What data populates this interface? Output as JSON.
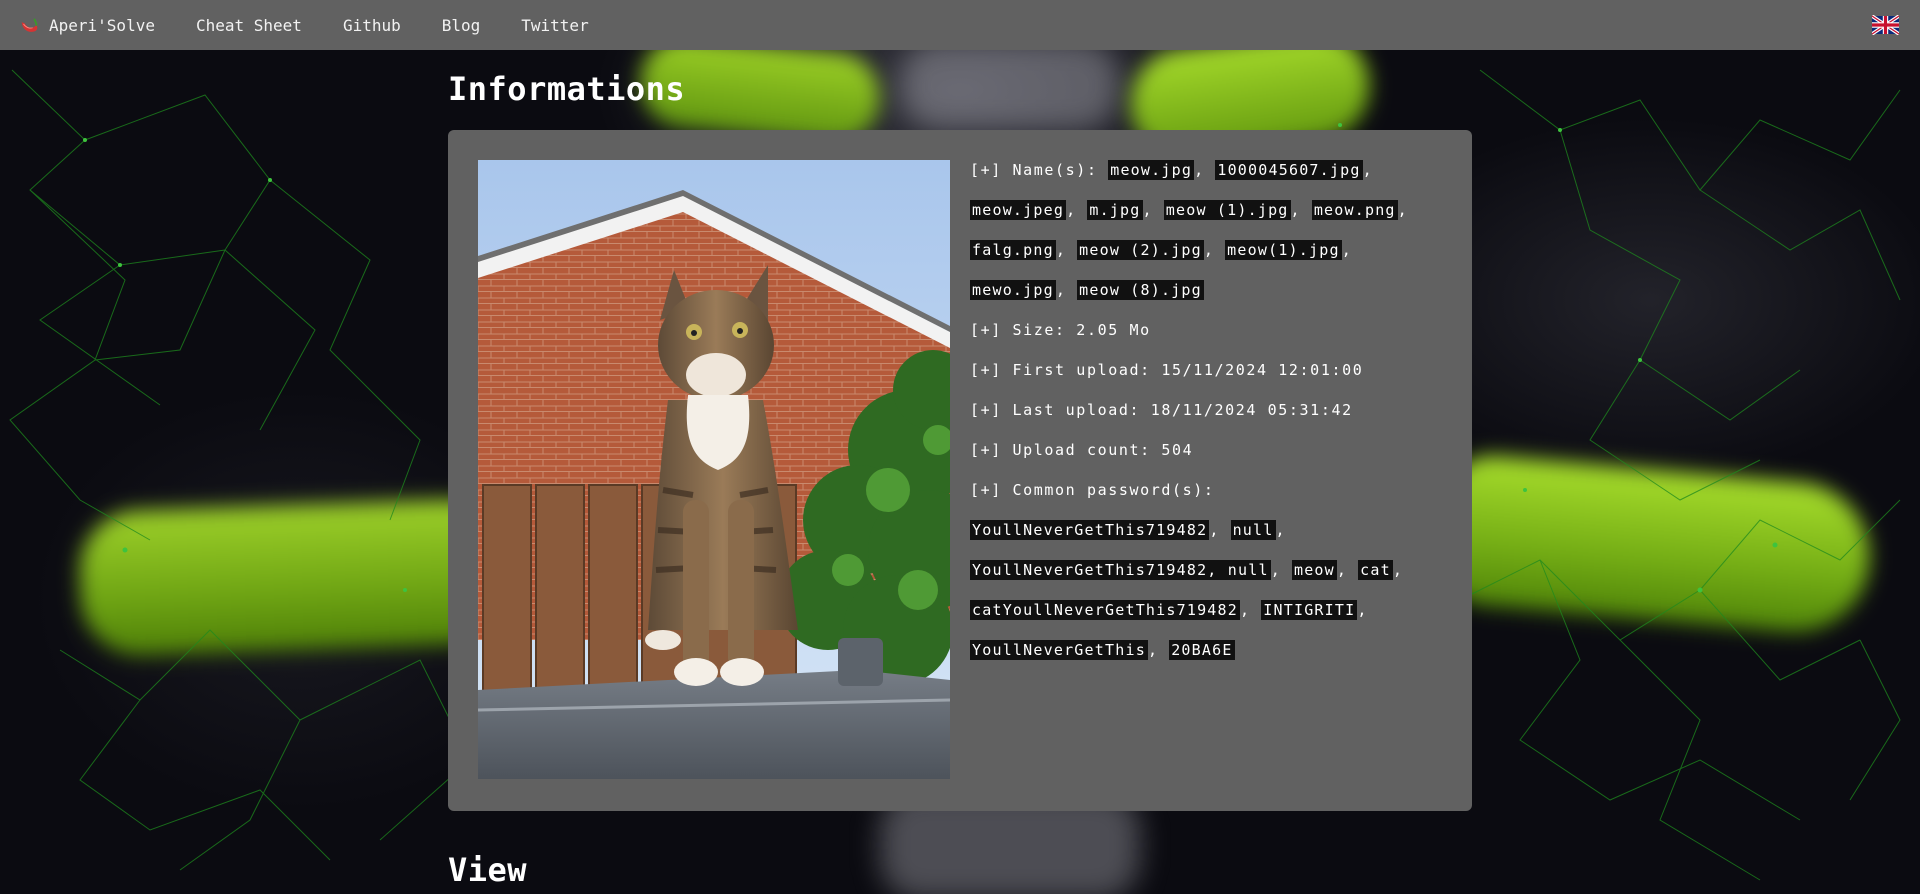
{
  "nav": {
    "brand": "Aperi'Solve",
    "links": [
      "Cheat Sheet",
      "Github",
      "Blog",
      "Twitter"
    ],
    "language_icon": "uk-flag-icon"
  },
  "informations": {
    "title": "Informations",
    "names_label": "[+] Name(s):",
    "names": [
      "meow.jpg",
      "1000045607.jpg",
      "meow.jpeg",
      "m.jpg",
      "meow (1).jpg",
      "meow.png",
      "falg.png",
      "meow (2).jpg",
      "meow(1).jpg",
      "mewo.jpg",
      "meow (8).jpg"
    ],
    "size": "[+] Size: 2.05 Mo",
    "first_upload": "[+] First upload: 15/11/2024 12:01:00",
    "last_upload": "[+] Last upload: 18/11/2024 05:31:42",
    "upload_count": "[+] Upload count: 504",
    "passwords_label": "[+] Common password(s):",
    "passwords": [
      "YoullNeverGetThis719482",
      "null",
      "YoullNeverGetThis719482, null",
      "meow",
      "cat",
      "catYoullNeverGetThis719482",
      "INTIGRITI",
      "YoullNeverGetThis",
      "20BA6E"
    ]
  },
  "view": {
    "title": "View"
  },
  "colors": {
    "navbar": "#616161",
    "card": "#616161",
    "chip": "#111111",
    "accent_green": "#8cc71f"
  }
}
